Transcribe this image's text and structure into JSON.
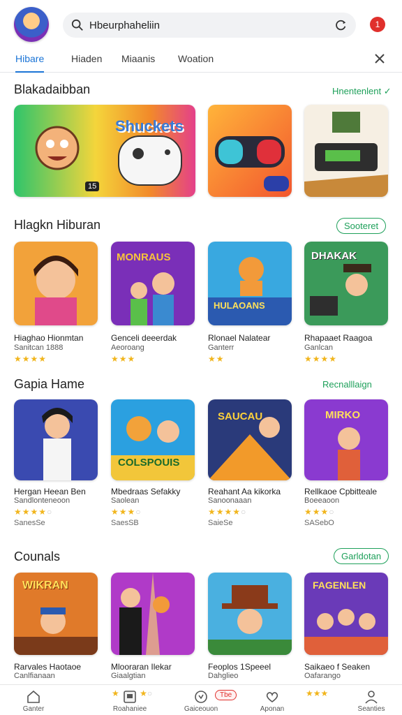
{
  "header": {
    "search_value": "Hbeurphaheliin",
    "notif_badge": "1"
  },
  "tabs": [
    {
      "label": "Hibare"
    },
    {
      "label": "Hiaden"
    },
    {
      "label": "Miaanis"
    },
    {
      "label": "Woation"
    }
  ],
  "sections": [
    {
      "title": "Blakadaibban",
      "see_all": "Hnentenlent"
    },
    {
      "title": "Hlagkn Hiburan",
      "see_all": "Sooteret"
    },
    {
      "title": "Gapia Hame",
      "see_all": "Recnalllaign"
    },
    {
      "title": "Counals",
      "see_all": "Garldotan"
    }
  ],
  "featured": {
    "banner_text": "Shuckets",
    "badge_count": "15"
  },
  "row1": [
    {
      "title": "Hiaghao Hionmtan",
      "sub": "Sanitcan 1888",
      "stars": 4,
      "art_text": ""
    },
    {
      "title": "Genceli deeerdak",
      "sub": "Aeoroang",
      "stars": 3,
      "art_text": "MONRAUS"
    },
    {
      "title": "Rlonael Nalatear",
      "sub": "Ganterr",
      "stars": 2,
      "art_text": "HULAOANS"
    },
    {
      "title": "Rhapaaet Raagoa",
      "sub": "Ganlcan",
      "stars": 4,
      "art_text": "DHAKAK"
    }
  ],
  "row2": [
    {
      "title": "Hergan Heean Ben",
      "sub": "Sandlonteneoon",
      "stars": 4,
      "count": "SanesSe",
      "art_text": ""
    },
    {
      "title": "Mbedraas Sefakky",
      "sub": "Saolean",
      "stars": 3,
      "count": "SaesSB",
      "art_text": "COLSPOUIS"
    },
    {
      "title": "Reahant Aa kikorka",
      "sub": "Sanoonaaan",
      "stars": 4,
      "count": "SaieSe",
      "art_text": "SAUCAU"
    },
    {
      "title": "Rellkaoe Cpbitteale",
      "sub": "Boeeaoon",
      "stars": 3,
      "count": "SASebO",
      "art_text": "MIRKO"
    }
  ],
  "row3": [
    {
      "title": "Rarvales Haotaoe",
      "sub": "Canlfianaan",
      "art_text": "WIKRAN"
    },
    {
      "title": "Mlooraran Ilekar",
      "sub": "Giaalgtian",
      "art_text": ""
    },
    {
      "title": "Feoplos 1Speeel",
      "sub": "Dahglieo",
      "art_text": ""
    },
    {
      "title": "Saikaeo f Seaken",
      "sub": "Oafarango",
      "art_text": "FAGENLEN"
    }
  ],
  "bottom_nav": [
    {
      "label": "Ganter"
    },
    {
      "label": "Roahaniee"
    },
    {
      "label": "Gaiceouon"
    },
    {
      "label": "Aponan"
    },
    {
      "label": "Seanties"
    }
  ],
  "bottom_badge": "Tbe",
  "colors": {
    "accent_blue": "#1b74d6",
    "accent_green": "#1ea05a",
    "star": "#f1b51c",
    "badge_red": "#e0302c"
  }
}
